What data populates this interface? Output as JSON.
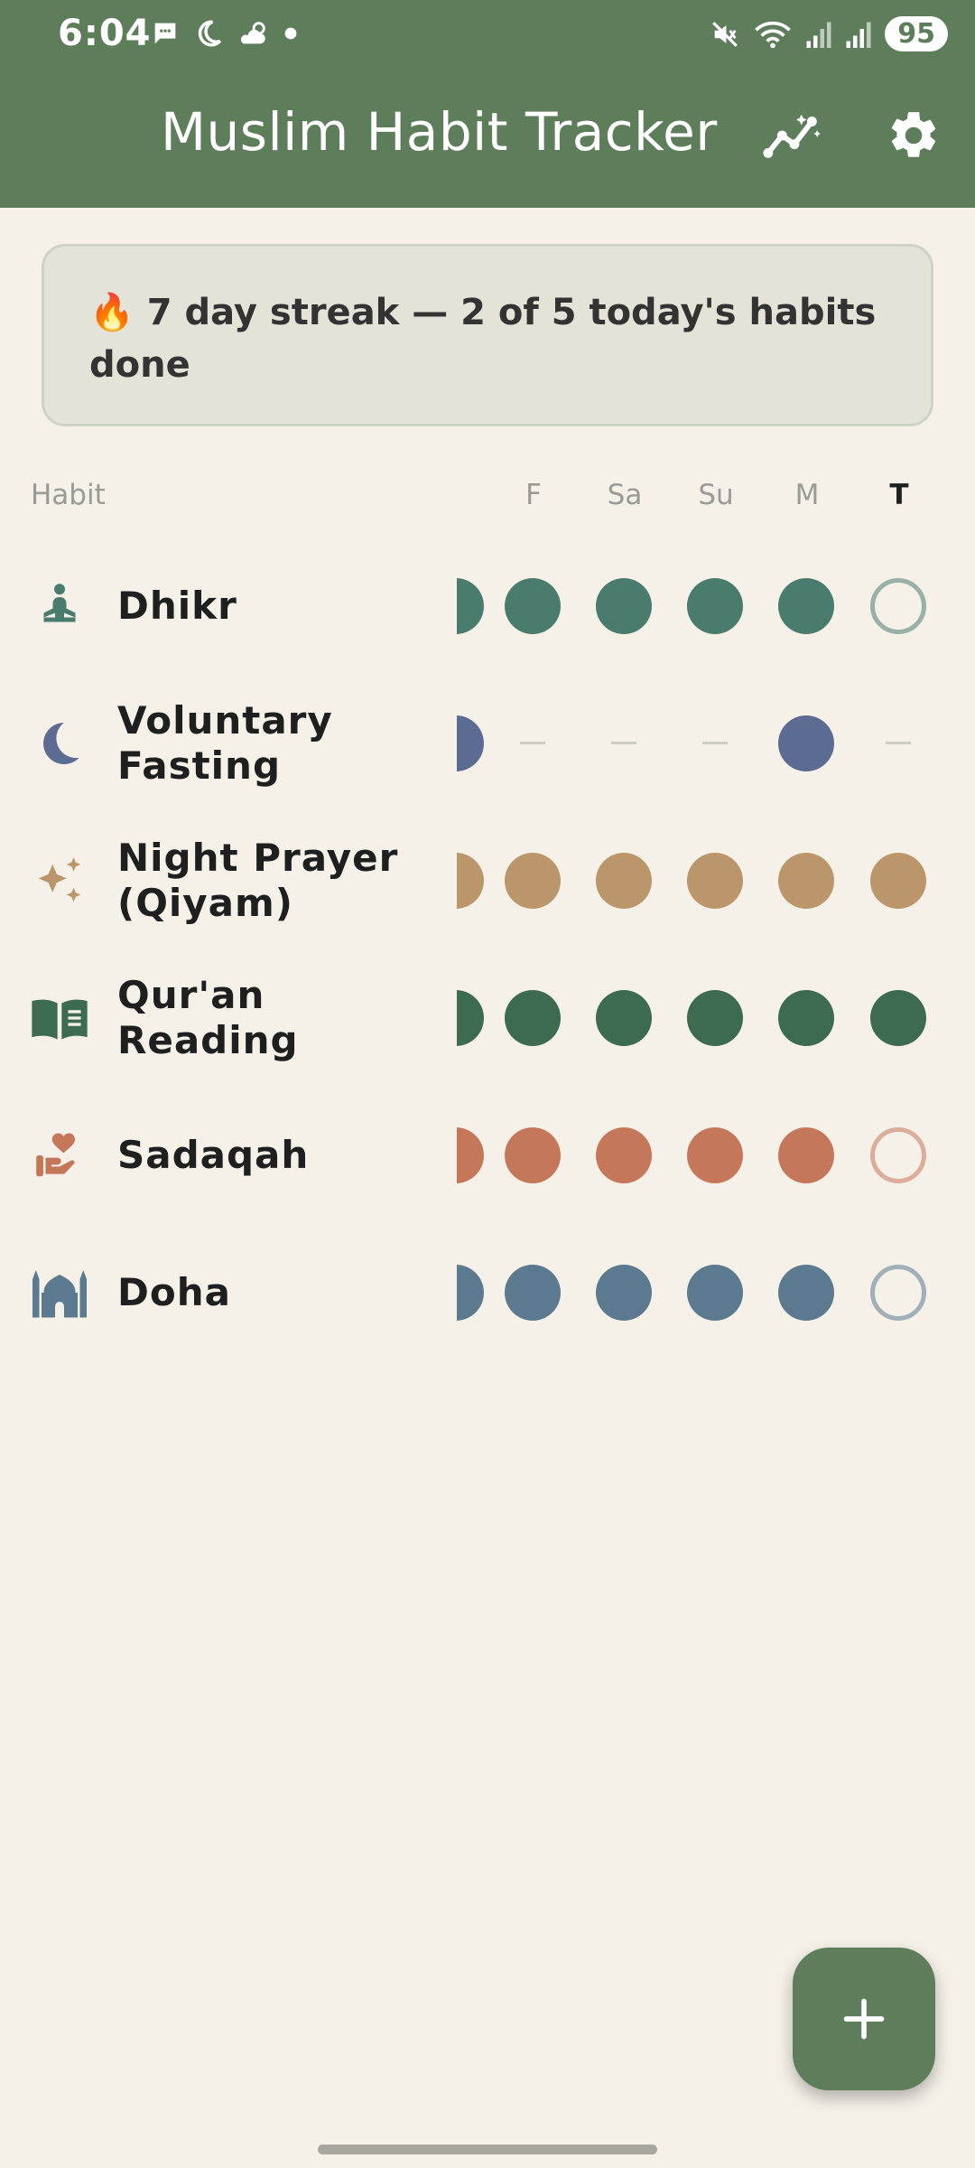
{
  "status_bar": {
    "time": "6:04",
    "battery": "95"
  },
  "app_bar": {
    "title": "Muslim Habit Tracker",
    "actions": [
      {
        "icon": "stats-chart-icon"
      },
      {
        "icon": "gear-icon"
      }
    ],
    "color": "#5E7D5A"
  },
  "streak_card": {
    "icon": "🔥",
    "text": "7 day streak — 2 of 5 today's habits done"
  },
  "table_header": {
    "habit_label": "Habit",
    "days": [
      "F",
      "Sa",
      "Su",
      "M",
      "T"
    ],
    "today_index": 4
  },
  "habits": [
    {
      "name": "Dhikr",
      "icon": "meditation-icon",
      "color": "#4A7C6D",
      "status": [
        "done",
        "done",
        "done",
        "done",
        "done",
        "empty"
      ]
    },
    {
      "name": "Voluntary Fasting",
      "icon": "crescent-moon-icon",
      "color": "#5B6B92",
      "status": [
        "done",
        "na",
        "na",
        "na",
        "done",
        "na"
      ]
    },
    {
      "name": "Night Prayer (Qiyam)",
      "icon": "sparkles-icon",
      "color": "#BA966A",
      "status": [
        "done",
        "done",
        "done",
        "done",
        "done",
        "done"
      ]
    },
    {
      "name": "Qur'an Reading",
      "icon": "open-book-icon",
      "color": "#3C6B4F",
      "status": [
        "done",
        "done",
        "done",
        "done",
        "done",
        "done"
      ]
    },
    {
      "name": "Sadaqah",
      "icon": "charity-hand-heart-icon",
      "color": "#C5775A",
      "status": [
        "done",
        "done",
        "done",
        "done",
        "done",
        "empty"
      ]
    },
    {
      "name": "Doha",
      "icon": "mosque-icon",
      "color": "#5B7A90",
      "status": [
        "done",
        "done",
        "done",
        "done",
        "done",
        "empty"
      ]
    }
  ],
  "fab": {
    "icon": "plus-icon",
    "label": "+"
  }
}
